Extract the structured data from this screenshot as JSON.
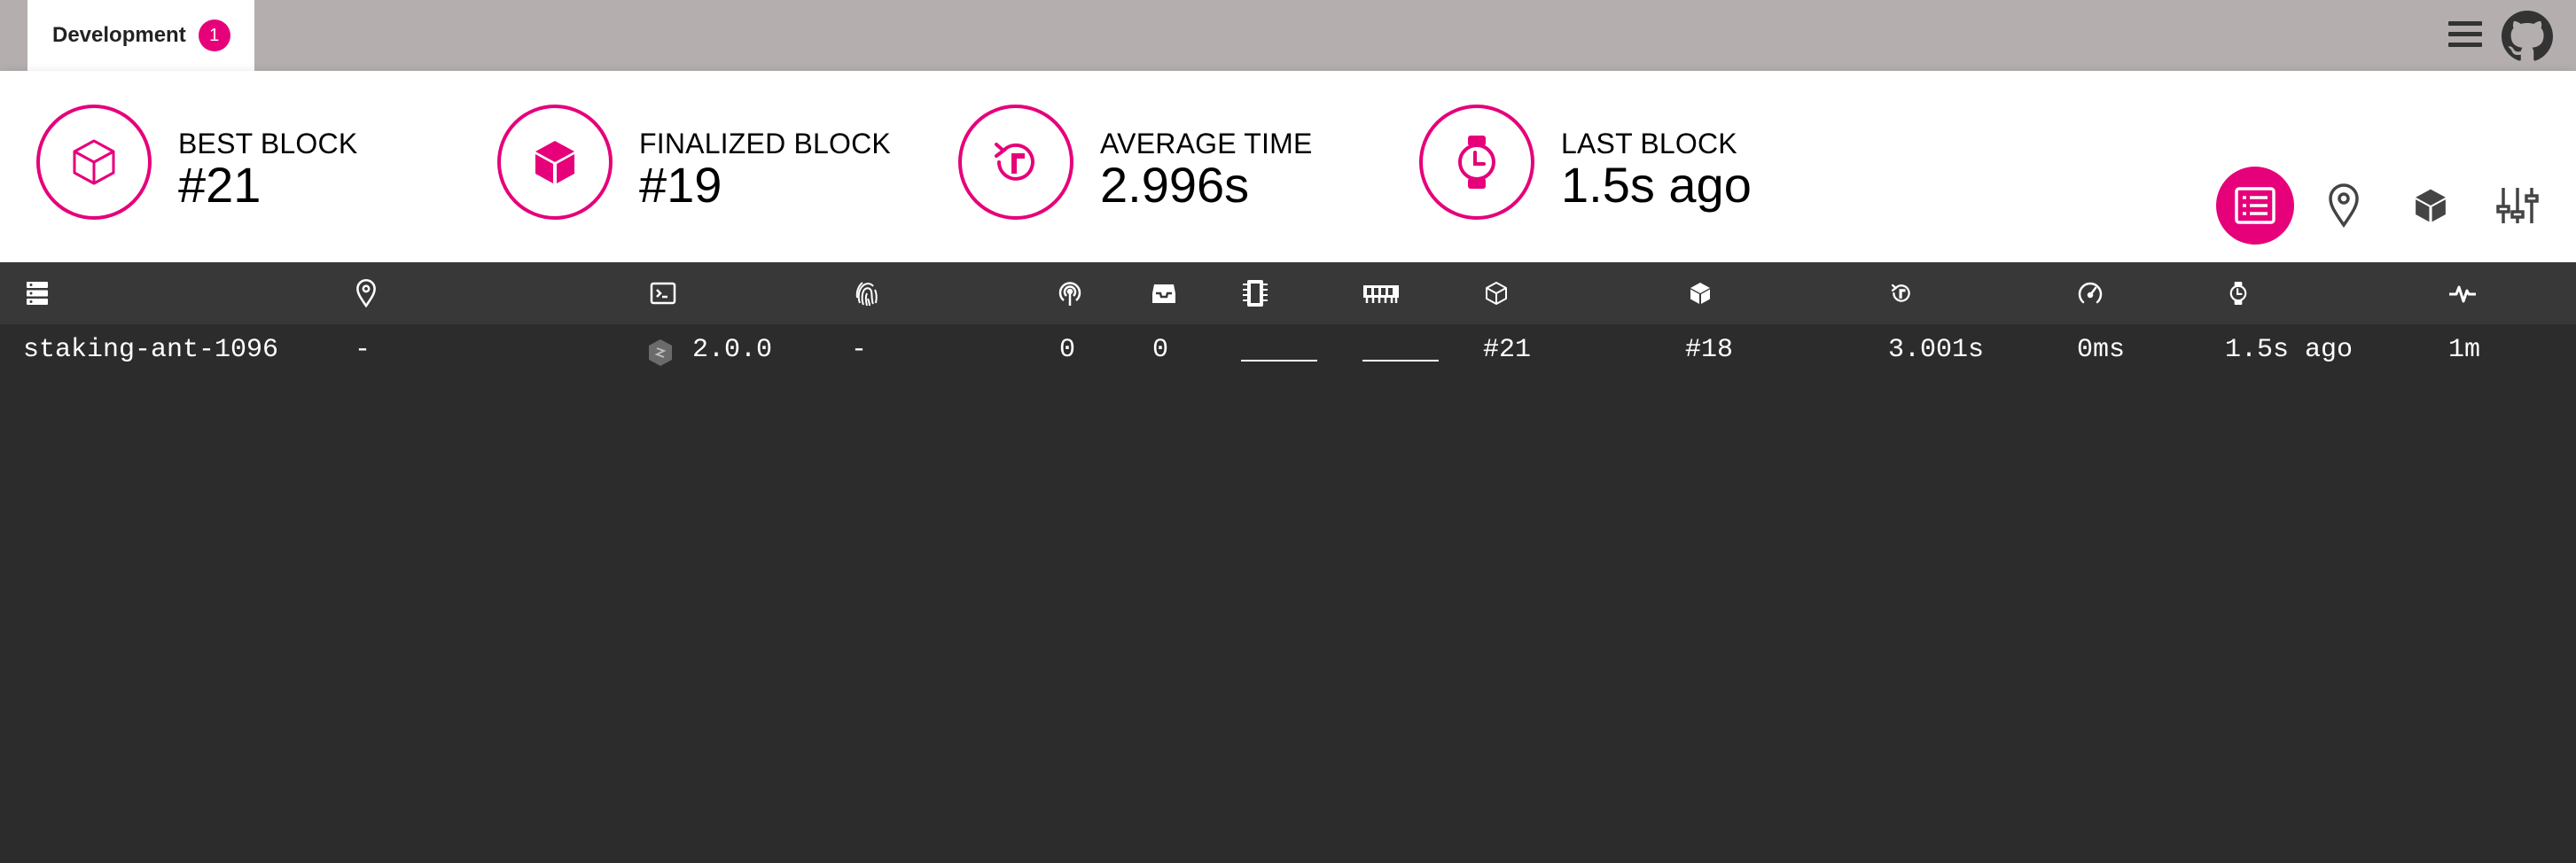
{
  "tabs": [
    {
      "label": "Development",
      "badge": "1"
    }
  ],
  "stats": {
    "best_block": {
      "label": "BEST BLOCK",
      "value": "#21"
    },
    "finalized_block": {
      "label": "FINALIZED BLOCK",
      "value": "#19"
    },
    "average_time": {
      "label": "AVERAGE TIME",
      "value": "2.996s"
    },
    "last_block": {
      "label": "LAST BLOCK",
      "value": "1.5s ago"
    }
  },
  "views": [
    "list",
    "map",
    "block",
    "settings"
  ],
  "active_view": "list",
  "table": {
    "columns": [
      {
        "icon": "node-name-icon"
      },
      {
        "icon": "location-icon"
      },
      {
        "icon": "implementation-icon"
      },
      {
        "icon": "network-id-icon"
      },
      {
        "icon": "peers-icon"
      },
      {
        "icon": "transactions-icon"
      },
      {
        "icon": "cpu-icon"
      },
      {
        "icon": "memory-icon"
      },
      {
        "icon": "best-block-icon"
      },
      {
        "icon": "finalized-block-icon"
      },
      {
        "icon": "block-time-icon"
      },
      {
        "icon": "propagation-icon"
      },
      {
        "icon": "last-block-icon"
      },
      {
        "icon": "uptime-icon"
      }
    ],
    "rows": [
      {
        "name": "staking-ant-1096",
        "location": "-",
        "version": "2.0.0",
        "network_id": "-",
        "peers": "0",
        "txs": "0",
        "best_block": "#21",
        "finalized_block": "#18",
        "block_time": "3.001s",
        "propagation": "0ms",
        "last_block": "1.5s ago",
        "uptime": "1m"
      }
    ]
  },
  "colors": {
    "accent": "#e6007a",
    "topbar": "#b4aeae",
    "table_bg": "#2c2c2c",
    "table_header_bg": "#383838"
  }
}
